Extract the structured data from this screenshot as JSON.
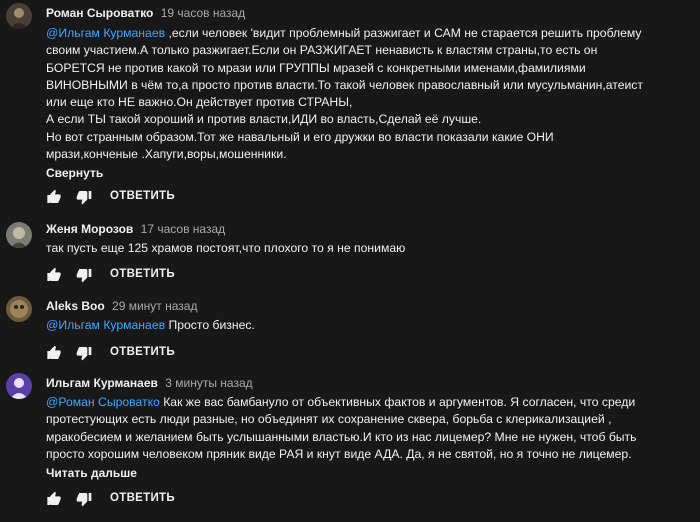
{
  "comments": [
    {
      "author": "Роман Сыроватко",
      "time": "19 часов назад",
      "mention": "@Ильгам Курманаев",
      "lines": [
        " ,если человек 'видит проблемный разжигает и САМ не старается решить проблему",
        "своим участием.А только разжигает.Если он РАЗЖИГАЕТ ненависть к властям страны,то есть он",
        "БОРЕТСЯ не против какой то мрази или ГРУППЫ мразей с конкретными именами,фамилиями",
        "ВИНОВНЫМИ в чём то,а просто против власти.То такой человек православный или мусульманин,атеист",
        "или еще кто НЕ важно.Он действует против СТРАНЫ,",
        "А если ТЫ такой хороший и против власти,ИДИ во власть,Сделай её лучше.",
        "Но вот странным образом.Тот же навальный и его дружки во власти показали какие ОНИ",
        "мрази,конченые .Хапуги,воры,мошенники."
      ],
      "more_label": "Свернуть",
      "reply_label": "ОТВЕТИТЬ"
    },
    {
      "author": "Женя Морозов",
      "time": "17 часов назад",
      "lines": [
        "так пусть еще 125 храмов постоят,что плохого то я не понимаю"
      ],
      "reply_label": "ОТВЕТИТЬ"
    },
    {
      "author": "Aleks Boo",
      "time": "29 минут назад",
      "mention": "@Ильгам Курманаев",
      "lines": [
        " Просто бизнес."
      ],
      "reply_label": "ОТВЕТИТЬ"
    },
    {
      "author": "Ильгам Курманаев",
      "time": "3 минуты назад",
      "mention": "@Роман Сыроватко",
      "lines": [
        " Как же вас бамбануло от объективных фактов и аргументов. Я согласен, что среди",
        "протестующих есть люди разные, но объединят их сохранение сквера, борьба с клерикализацией ,",
        "мракобесием и желанием быть услышанными  властью.И кто из нас лицемер? Мне не нужен, чтоб быть",
        "просто  хорошим человеком пряник виде РАЯ и кнут виде АДА. Да, я не святой, но я точно не лицемер."
      ],
      "more_label": "Читать дальше",
      "reply_label": "ОТВЕТИТЬ"
    }
  ],
  "colors": {
    "background": "#181818",
    "text": "#f1f1f1",
    "secondary": "#aaaaaa",
    "link": "#3ea6ff"
  }
}
